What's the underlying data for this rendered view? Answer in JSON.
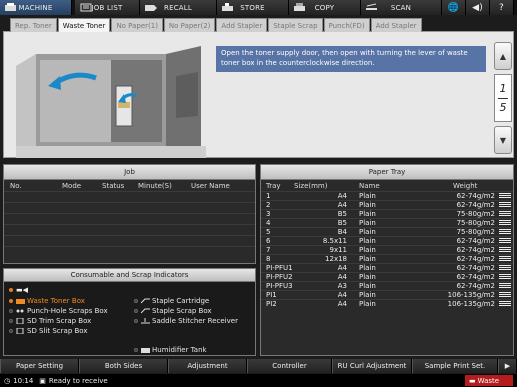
{
  "topbar": {
    "machine": "MACHINE",
    "job_list": "JOB LIST",
    "recall": "RECALL",
    "store": "STORE",
    "copy": "COPY",
    "scan": "SCAN"
  },
  "tabs": [
    {
      "label": "Rep. Toner",
      "active": false
    },
    {
      "label": "Waste Toner",
      "active": true
    },
    {
      "label": "No Paper(1)",
      "active": false
    },
    {
      "label": "No Paper(2)",
      "active": false
    },
    {
      "label": "Add Stapler",
      "active": false
    },
    {
      "label": "Staple Scrap",
      "active": false
    },
    {
      "label": "Punch(FD)",
      "active": false
    },
    {
      "label": "Add Stapler",
      "active": false
    }
  ],
  "message": "Open the toner supply door, then open with turning the lever of waste toner box in the counterclockwise direction.",
  "pager": {
    "current": "1",
    "total": "5"
  },
  "job": {
    "title": "Job",
    "columns": [
      "No.",
      "Mode",
      "Status",
      "Minute(S)",
      "User Name"
    ]
  },
  "consumables": {
    "title": "Consumable and Scrap Indicators",
    "left": [
      {
        "label": "Waste Toner Box",
        "icon": "waste-toner-icon",
        "state": "alert"
      },
      {
        "label": "Punch-Hole Scraps Box",
        "icon": "punch-icon",
        "state": "normal"
      },
      {
        "label": "SD Trim Scrap Box",
        "icon": "trim-icon",
        "state": "normal"
      },
      {
        "label": "SD Slit Scrap Box",
        "icon": "slit-icon",
        "state": "normal"
      }
    ],
    "right": [
      {
        "label": "Staple Cartridge",
        "icon": "staple-icon"
      },
      {
        "label": "Staple Scrap Box",
        "icon": "staple-scrap-icon"
      },
      {
        "label": "Saddle Stitcher Receiver",
        "icon": "saddle-icon"
      },
      {
        "label": "Humidifier Tank",
        "icon": "humidifier-icon"
      }
    ],
    "alert_color": "#f08a22"
  },
  "tray": {
    "title": "Paper Tray",
    "columns": [
      "Tray",
      "Size(mm)",
      "Name",
      "Weight"
    ],
    "rows": [
      {
        "tray": "1",
        "size": "A4",
        "name": "Plain",
        "weight": "62-74g/m2"
      },
      {
        "tray": "2",
        "size": "A4",
        "name": "Plain",
        "weight": "62-74g/m2"
      },
      {
        "tray": "3",
        "size": "B5",
        "name": "Plain",
        "weight": "75-80g/m2"
      },
      {
        "tray": "4",
        "size": "B5",
        "name": "Plain",
        "weight": "75-80g/m2"
      },
      {
        "tray": "5",
        "size": "B4",
        "name": "Plain",
        "weight": "75-80g/m2"
      },
      {
        "tray": "6",
        "size": "8.5x11",
        "name": "Plain",
        "weight": "62-74g/m2"
      },
      {
        "tray": "7",
        "size": "9x11",
        "name": "Plain",
        "weight": "62-74g/m2"
      },
      {
        "tray": "8",
        "size": "12x18",
        "name": "Plain",
        "weight": "62-74g/m2"
      },
      {
        "tray": "PI-PFU1",
        "size": "A4",
        "name": "Plain",
        "weight": "62-74g/m2"
      },
      {
        "tray": "PI-PFU2",
        "size": "A4",
        "name": "Plain",
        "weight": "62-74g/m2"
      },
      {
        "tray": "PI-PFU3",
        "size": "A3",
        "name": "Plain",
        "weight": "62-74g/m2"
      },
      {
        "tray": "PI1",
        "size": "A4",
        "name": "Plain",
        "weight": "106-135g/m2"
      },
      {
        "tray": "PI2",
        "size": "A4",
        "name": "Plain",
        "weight": "106-135g/m2"
      }
    ]
  },
  "functions": [
    "Paper Setting",
    "Both Sides",
    "Adjustment",
    "Controller",
    "RU Curl Adjustment",
    "Sample Print Set."
  ],
  "status": {
    "time": "10:14",
    "text": "Ready to receive",
    "alert": "Waste"
  },
  "colors": {
    "accent": "#5873a6",
    "alert": "#b31d1d"
  }
}
